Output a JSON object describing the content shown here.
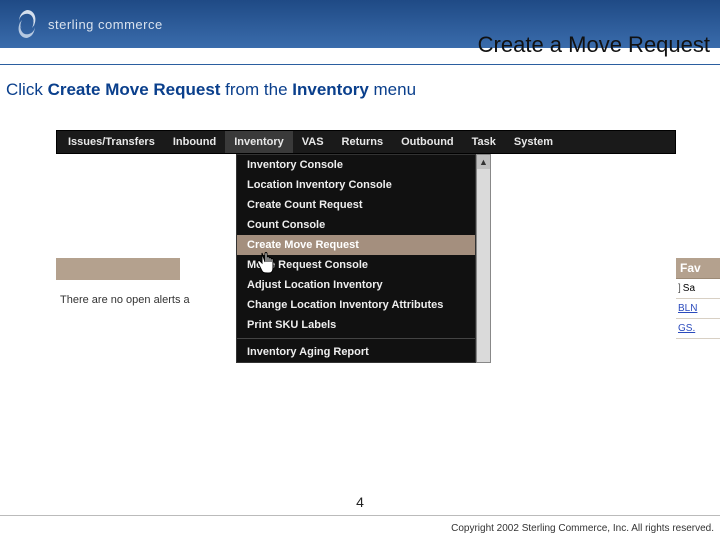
{
  "header": {
    "brand": "sterling commerce",
    "page_title": "Create a Move Request"
  },
  "instruction": {
    "prefix": "Click ",
    "bold1": "Create Move Request",
    "mid": " from the ",
    "bold2": "Inventory",
    "suffix": " menu"
  },
  "menu_bar": {
    "items": [
      "Issues/Transfers",
      "Inbound",
      "Inventory",
      "VAS",
      "Returns",
      "Outbound",
      "Task",
      "System"
    ],
    "active_index": 2
  },
  "dropdown": {
    "items": [
      "Inventory Console",
      "Location Inventory Console",
      "Create Count Request",
      "Count Console",
      "Create Move Request",
      "Move Request Console",
      "Adjust Location Inventory",
      "Change Location Inventory Attributes",
      "Print SKU Labels"
    ],
    "hovered_index": 4,
    "items_after_sep": [
      "Inventory Aging Report"
    ]
  },
  "alerts": {
    "none_text": "There are no open alerts a"
  },
  "side": {
    "fav_header": "Fav",
    "rows": [
      {
        "bracket": "]",
        "text": "Sa"
      },
      {
        "bracket": "",
        "text": "BLN"
      },
      {
        "bracket": "",
        "text": "GS."
      }
    ]
  },
  "footer": {
    "page_number": "4",
    "copyright": "Copyright 2002 Sterling Commerce, Inc. All rights reserved."
  }
}
